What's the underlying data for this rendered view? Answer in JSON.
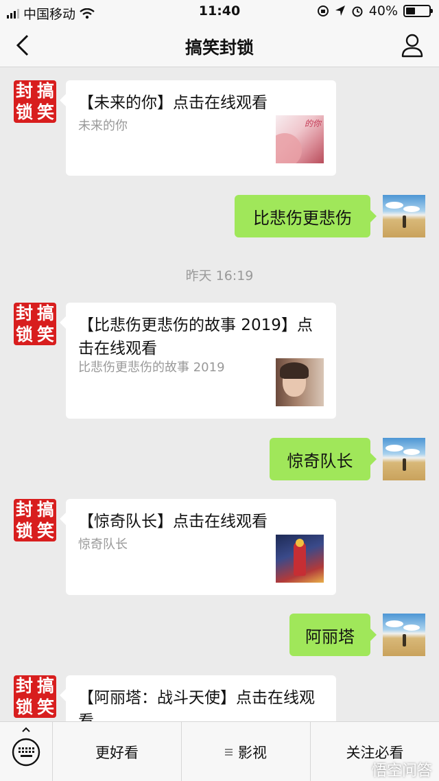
{
  "status_bar": {
    "carrier": "中国移动",
    "time": "11:40",
    "battery": "40%",
    "battery_level": 0.4
  },
  "nav": {
    "title": "搞笑封锁"
  },
  "official_account": {
    "seal_chars": [
      "搞",
      "笑",
      "封",
      "锁"
    ]
  },
  "messages": [
    {
      "type": "card",
      "side": "left",
      "title": "【未来的你】点击在线观看",
      "desc": "未来的你",
      "thumb_text": "的你"
    },
    {
      "type": "text",
      "side": "right",
      "text": "比悲伤更悲伤"
    },
    {
      "type": "time",
      "text": "昨天 16:19"
    },
    {
      "type": "card",
      "side": "left",
      "title": "【比悲伤更悲伤的故事 2019】点击在线观看",
      "desc": "比悲伤更悲伤的故事 2019"
    },
    {
      "type": "text",
      "side": "right",
      "text": "惊奇队长"
    },
    {
      "type": "card",
      "side": "left",
      "title": "【惊奇队长】点击在线观看",
      "desc": "惊奇队长"
    },
    {
      "type": "text",
      "side": "right",
      "text": "阿丽塔"
    },
    {
      "type": "card",
      "side": "left",
      "title": "【阿丽塔：战斗天使】点击在线观看",
      "desc": ""
    }
  ],
  "bottom_menu": {
    "items": [
      "更好看",
      "影视",
      "关注必看"
    ]
  },
  "watermark": "悟空问答"
}
